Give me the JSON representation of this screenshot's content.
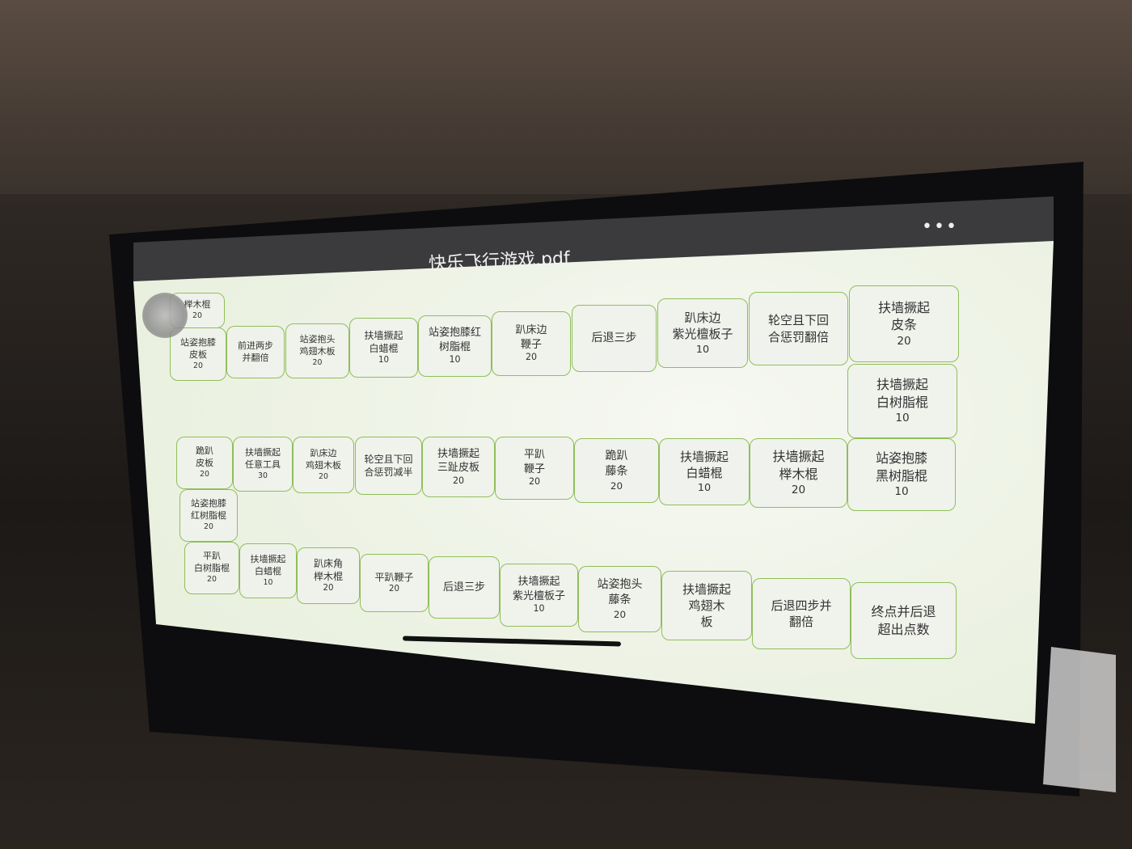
{
  "header": {
    "title": "快乐飞行游戏.pdf",
    "back_icon": "chevron-left-icon",
    "more_icon": "more-dots-icon",
    "more_label": "•••",
    "back_label": "‹"
  },
  "colors": {
    "tile_border": "#8fbf5a",
    "page_bg": "#eef3e6",
    "toolbar_bg": "#3b3b3d"
  },
  "tiles": [
    {
      "lines": [
        "榉木棍"
      ],
      "value": "20"
    },
    {
      "lines": [
        "站姿抱膝",
        "皮板"
      ],
      "value": "20"
    },
    {
      "lines": [
        "前进两步",
        "并翻倍"
      ],
      "value": ""
    },
    {
      "lines": [
        "站姿抱头",
        "鸡翅木板"
      ],
      "value": "20"
    },
    {
      "lines": [
        "扶墙撅起",
        "白蜡棍"
      ],
      "value": "10"
    },
    {
      "lines": [
        "站姿抱膝红",
        "树脂棍"
      ],
      "value": "10"
    },
    {
      "lines": [
        "趴床边",
        "鞭子"
      ],
      "value": "20"
    },
    {
      "lines": [
        "后退三步"
      ],
      "value": ""
    },
    {
      "lines": [
        "趴床边",
        "紫光檀板子"
      ],
      "value": "10"
    },
    {
      "lines": [
        "轮空且下回",
        "合惩罚翻倍"
      ],
      "value": ""
    },
    {
      "lines": [
        "扶墙撅起",
        "皮条"
      ],
      "value": "20"
    },
    {
      "lines": [
        "扶墙撅起",
        "白树脂棍"
      ],
      "value": "10"
    },
    {
      "lines": [
        "跪趴",
        "皮板"
      ],
      "value": "20"
    },
    {
      "lines": [
        "扶墙撅起",
        "任意工具"
      ],
      "value": "30"
    },
    {
      "lines": [
        "趴床边",
        "鸡翅木板"
      ],
      "value": "20"
    },
    {
      "lines": [
        "轮空且下回",
        "合惩罚减半"
      ],
      "value": ""
    },
    {
      "lines": [
        "扶墙撅起",
        "三趾皮板"
      ],
      "value": "20"
    },
    {
      "lines": [
        "平趴",
        "鞭子"
      ],
      "value": "20"
    },
    {
      "lines": [
        "跪趴",
        "藤条"
      ],
      "value": "20"
    },
    {
      "lines": [
        "扶墙撅起",
        "白蜡棍"
      ],
      "value": "10"
    },
    {
      "lines": [
        "扶墙撅起",
        "榉木棍"
      ],
      "value": "20"
    },
    {
      "lines": [
        "站姿抱膝",
        "黑树脂棍"
      ],
      "value": "10"
    },
    {
      "lines": [
        "站姿抱膝",
        "红树脂棍"
      ],
      "value": "20"
    },
    {
      "lines": [
        "平趴",
        "白树脂棍"
      ],
      "value": "20"
    },
    {
      "lines": [
        "扶墙撅起",
        "白蜡棍"
      ],
      "value": "10"
    },
    {
      "lines": [
        "趴床角",
        "榉木棍"
      ],
      "value": "20"
    },
    {
      "lines": [
        "平趴鞭子"
      ],
      "value": "20"
    },
    {
      "lines": [
        "后退三步"
      ],
      "value": ""
    },
    {
      "lines": [
        "扶墙撅起",
        "紫光檀板子"
      ],
      "value": "10"
    },
    {
      "lines": [
        "站姿抱头",
        "藤条"
      ],
      "value": "20"
    },
    {
      "lines": [
        "扶墙撅起",
        "鸡翅木",
        "板"
      ],
      "value": ""
    },
    {
      "lines": [
        "后退四步并",
        "翻倍"
      ],
      "value": ""
    },
    {
      "lines": [
        "终点并后退",
        "超出点数"
      ],
      "value": ""
    }
  ]
}
